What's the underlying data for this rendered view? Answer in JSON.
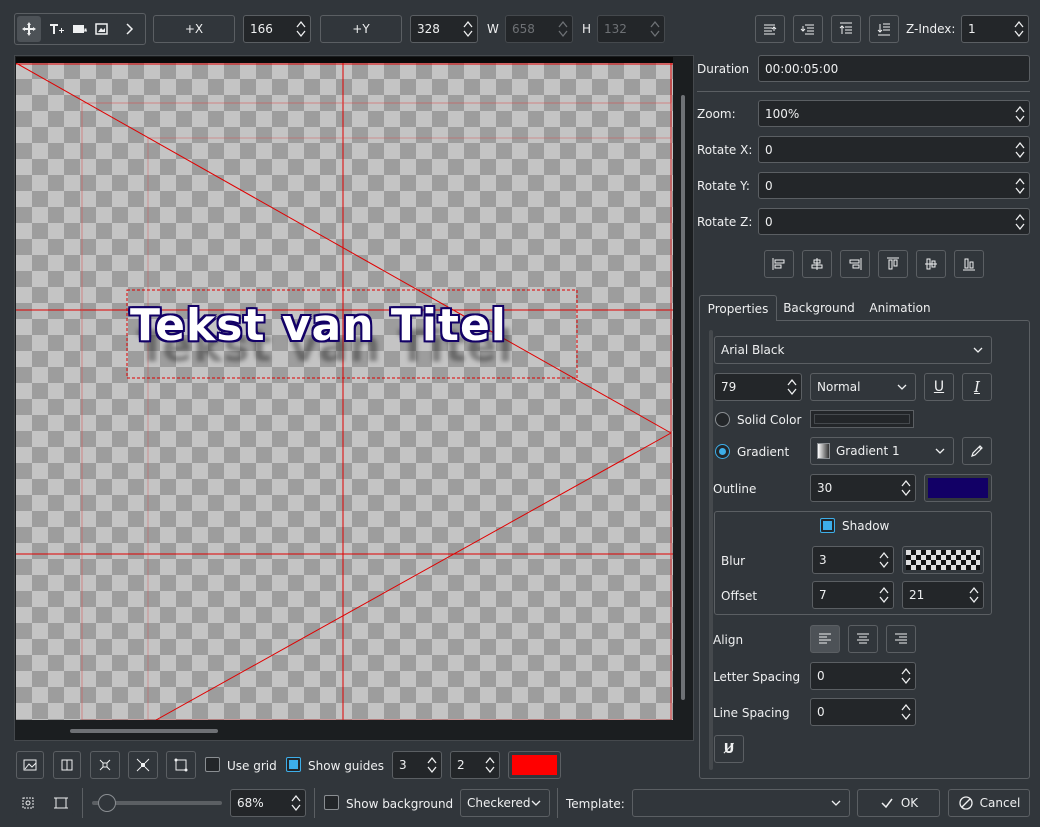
{
  "toolbar": {
    "plus_x_label": "+X",
    "x_value": "166",
    "plus_y_label": "+Y",
    "y_value": "328",
    "w_label": "W",
    "w_value": "658",
    "h_label": "H",
    "h_value": "132",
    "zindex_label": "Z-Index:",
    "zindex_value": "1"
  },
  "canvas": {
    "title_text": "Tekst van Titel",
    "guide_color": "#ff0000",
    "text_color": "#ffffff",
    "outline_color": "#120066"
  },
  "props": {
    "duration_label": "Duration",
    "duration_value": "00:00:05:00",
    "zoom_label": "Zoom:",
    "zoom_value": "100%",
    "rotate_x_label": "Rotate X:",
    "rotate_x_value": "0",
    "rotate_y_label": "Rotate Y:",
    "rotate_y_value": "0",
    "rotate_z_label": "Rotate Z:",
    "rotate_z_value": "0"
  },
  "tabs": [
    {
      "label": "Properties"
    },
    {
      "label": "Background"
    },
    {
      "label": "Animation"
    }
  ],
  "text_props": {
    "font_family": "Arial Black",
    "font_size": "79",
    "font_weight": "Normal",
    "underline_glyph": "U",
    "italic_glyph": "I",
    "solid_color_label": "Solid Color",
    "gradient_label": "Gradient",
    "gradient_value": "Gradient 1",
    "outline_label": "Outline",
    "outline_value": "30",
    "outline_color": "#120066",
    "shadow_label": "Shadow",
    "blur_label": "Blur",
    "blur_value": "3",
    "offset_label": "Offset",
    "offset_x": "7",
    "offset_y": "21",
    "align_label": "Align",
    "letter_spacing_label": "Letter Spacing",
    "letter_spacing_value": "0",
    "line_spacing_label": "Line Spacing",
    "line_spacing_value": "0",
    "typewriter_glyph": "U̸"
  },
  "bottom": {
    "use_grid_label": "Use grid",
    "show_guides_label": "Show guides",
    "guides_h": "3",
    "guides_v": "2",
    "guide_color": "#ff0000",
    "zoom_value": "68%",
    "show_background_label": "Show background",
    "background_mode": "Checkered",
    "template_label": "Template:",
    "template_value": "",
    "ok_label": "OK",
    "cancel_label": "Cancel"
  }
}
